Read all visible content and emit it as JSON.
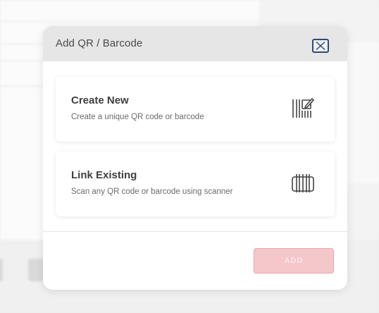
{
  "modal": {
    "title": "Add QR / Barcode",
    "close_icon": "close-icon",
    "options": [
      {
        "title": "Create New",
        "subtitle": "Create a unique QR code or barcode",
        "icon": "barcode-edit-icon"
      },
      {
        "title": "Link Existing",
        "subtitle": "Scan any QR code or barcode using scanner",
        "icon": "barcode-scanner-icon"
      }
    ],
    "add_button": "ADD",
    "add_button_state": "disabled"
  },
  "colors": {
    "header_bg": "#e6e6e6",
    "add_button_bg": "#f4c7cb",
    "close_border": "#2d4a7a"
  }
}
